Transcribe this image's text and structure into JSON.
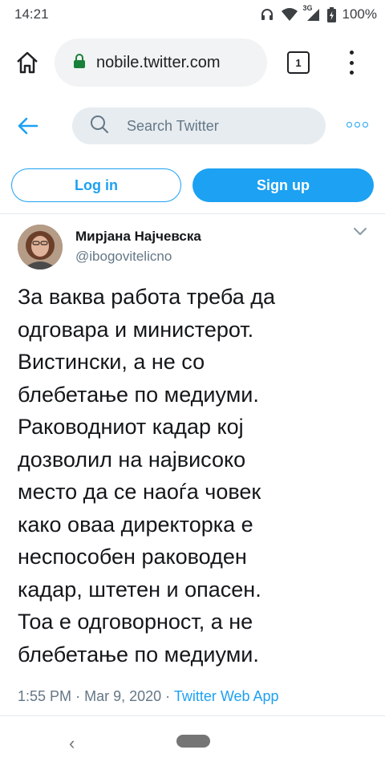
{
  "status_bar": {
    "time": "14:21",
    "network": "3G",
    "battery": "100%"
  },
  "browser": {
    "url": "nobile.twitter.com",
    "tab_count": "1"
  },
  "twitter": {
    "search_placeholder": "Search Twitter",
    "login_label": "Log in",
    "signup_label": "Sign up",
    "accent_color": "#1da1f2"
  },
  "tweet": {
    "author_name": "Мирјана Најчевска",
    "author_handle": "@ibogovitelicno",
    "text_lines": [
      "За ваква работа треба да",
      "одговара и министерот.",
      "Вистински, а не со",
      "блебетање по медиуми.",
      "Раководниот кадар кој",
      "дозволил на највисоко",
      "место да се наоѓа човек",
      "како оваа директорка е",
      "неспособен раководен",
      "кадар, штетен и опасен.",
      "Тоа е одговорност, а не",
      "блебетање по медиуми."
    ],
    "time": "1:55 PM",
    "date": "Mar 9, 2020",
    "separator": "·",
    "source": "Twitter Web App"
  },
  "nav": {
    "back_glyph": "‹"
  }
}
